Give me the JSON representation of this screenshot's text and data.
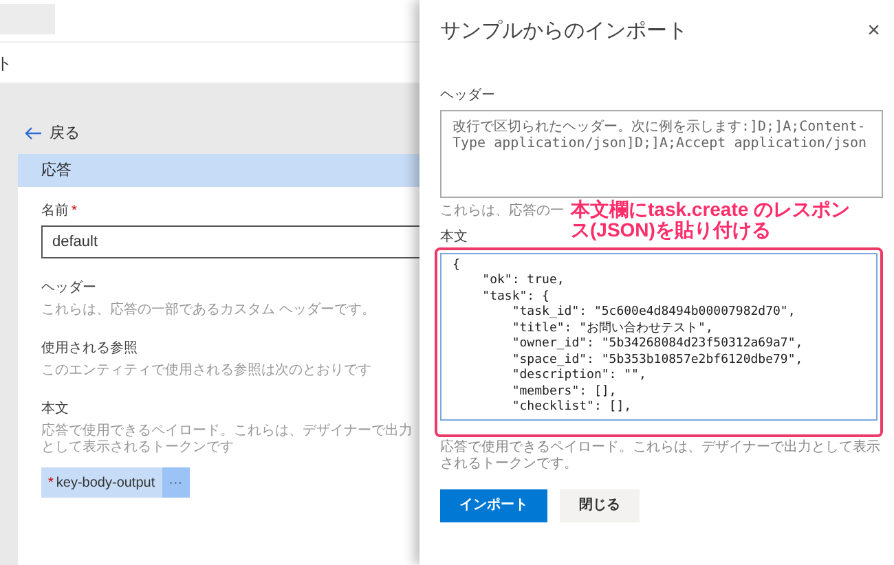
{
  "background_page": {
    "partial_title": "ト",
    "back_link": "戻る",
    "section_title": "応答",
    "name_field": {
      "label": "名前",
      "required_mark": "*",
      "value": "default"
    },
    "fields": [
      {
        "label": "ヘッダー",
        "hint": "これらは、応答の一部であるカスタム ヘッダーです。"
      },
      {
        "label": "使用される参照",
        "hint": "このエンティティで使用される参照は次のとおりです"
      },
      {
        "label": "本文",
        "hint": "応答で使用できるペイロード。これらは、デザイナーで出力として表示されるトークンです"
      }
    ],
    "token": {
      "required_mark": "*",
      "label": "key-body-output",
      "menu": "···"
    }
  },
  "dialog": {
    "title": "サンプルからのインポート",
    "close": "×",
    "header_field": {
      "label": "ヘッダー",
      "placeholder": "改行で区切られたヘッダー。次に例を示します:]D;]A;Content-Type application/json]D;]A;Accept application/json",
      "hint": "これらは、応答の一"
    },
    "annotation": "本文欄にtask.create のレスポンス(JSON)を貼り付ける",
    "body_field": {
      "label": "本文",
      "value": "{\n    \"ok\": true,\n    \"task\": {\n        \"task_id\": \"5c600e4d8494b00007982d70\",\n        \"title\": \"お問い合わせテスト\",\n        \"owner_id\": \"5b34268084d23f50312a69a7\",\n        \"space_id\": \"5b353b10857e2bf6120dbe79\",\n        \"description\": \"\",\n        \"members\": [],\n        \"checklist\": [],",
      "hint": "応答で使用できるペイロード。これらは、デザイナーで出力として表示されるトークンです。"
    },
    "buttons": [
      {
        "label": "インポート",
        "kind": "primary"
      },
      {
        "label": "閉じる",
        "kind": "secondary"
      }
    ]
  }
}
